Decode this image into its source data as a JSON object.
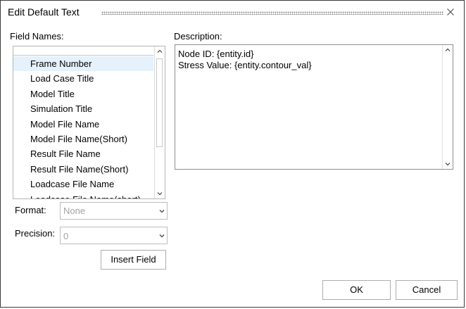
{
  "dialog": {
    "title": "Edit Default Text",
    "close_glyph": "×"
  },
  "field_names": {
    "label": "Field Names:",
    "items": [
      "Frame Number",
      "Load Case Title",
      "Model Title",
      "Simulation Title",
      "Model File Name",
      "Model File Name(Short)",
      "Result File Name",
      "Result File Name(Short)",
      "Loadcase File Name",
      "Loadcase File Name(short)"
    ],
    "selected_index": 0
  },
  "description": {
    "label": "Description:",
    "lines": [
      "Node ID: {entity.id}",
      "Stress Value: {entity.contour_val}"
    ]
  },
  "format": {
    "label": "Format:",
    "value": "None"
  },
  "precision": {
    "label": "Precision:",
    "value": "0"
  },
  "buttons": {
    "insert_field": "Insert Field",
    "ok": "OK",
    "cancel": "Cancel"
  },
  "colors": {
    "selection": "#e5f1fb",
    "border": "#3a3a3a",
    "disabled_text": "#a3a3a3"
  },
  "icons": {
    "close": "close-icon",
    "scroll_up": "chevron-up-icon",
    "scroll_down": "chevron-down-icon",
    "dropdown": "chevron-down-icon"
  }
}
